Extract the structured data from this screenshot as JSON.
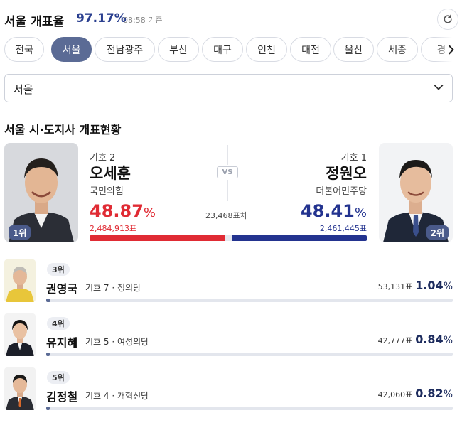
{
  "header": {
    "title": "서울 개표율",
    "rate": "97.17%",
    "time": "08:58 기준"
  },
  "tabs": [
    "전국",
    "서울",
    "전남광주",
    "부산",
    "대구",
    "인천",
    "대전",
    "울산",
    "세종",
    "경"
  ],
  "active_tab": "서울",
  "region_select": {
    "value": "서울"
  },
  "section_title": "서울 시·도지사 개표현황",
  "leaders": {
    "left": {
      "number_label": "기호 2",
      "name": "오세훈",
      "party": "국민의힘",
      "pct_value": "48.87",
      "pct_unit": "%",
      "votes": "2,484,913표",
      "rank": "1위",
      "share": 48.87,
      "color": "#e02b34"
    },
    "right": {
      "number_label": "기호 1",
      "name": "정원오",
      "party": "더불어민주당",
      "pct_value": "48.41",
      "pct_unit": "%",
      "votes": "2,461,445표",
      "rank": "2위",
      "share": 48.41,
      "color": "#23338f"
    },
    "vs": "VS",
    "difference": "23,468표차"
  },
  "others": [
    {
      "rank": "3위",
      "name": "권영국",
      "number_label": "기호 7",
      "party": "정의당",
      "votes": "53,131표",
      "pct_value": "1.04",
      "pct_unit": "%",
      "share": 1.04
    },
    {
      "rank": "4위",
      "name": "유지혜",
      "number_label": "기호 5",
      "party": "여성의당",
      "votes": "42,777표",
      "pct_value": "0.84",
      "pct_unit": "%",
      "share": 0.84
    },
    {
      "rank": "5위",
      "name": "김정철",
      "number_label": "기호 4",
      "party": "개혁신당",
      "votes": "42,060표",
      "pct_value": "0.82",
      "pct_unit": "%",
      "share": 0.82
    }
  ],
  "colors": {
    "accent": "#5b6b95",
    "rate": "#2a3f8f",
    "red": "#e02b34",
    "blue": "#23338f"
  },
  "icons": {
    "refresh": "refresh-icon",
    "tabs_next": "chevron-right-icon",
    "select": "chevron-down-icon"
  }
}
